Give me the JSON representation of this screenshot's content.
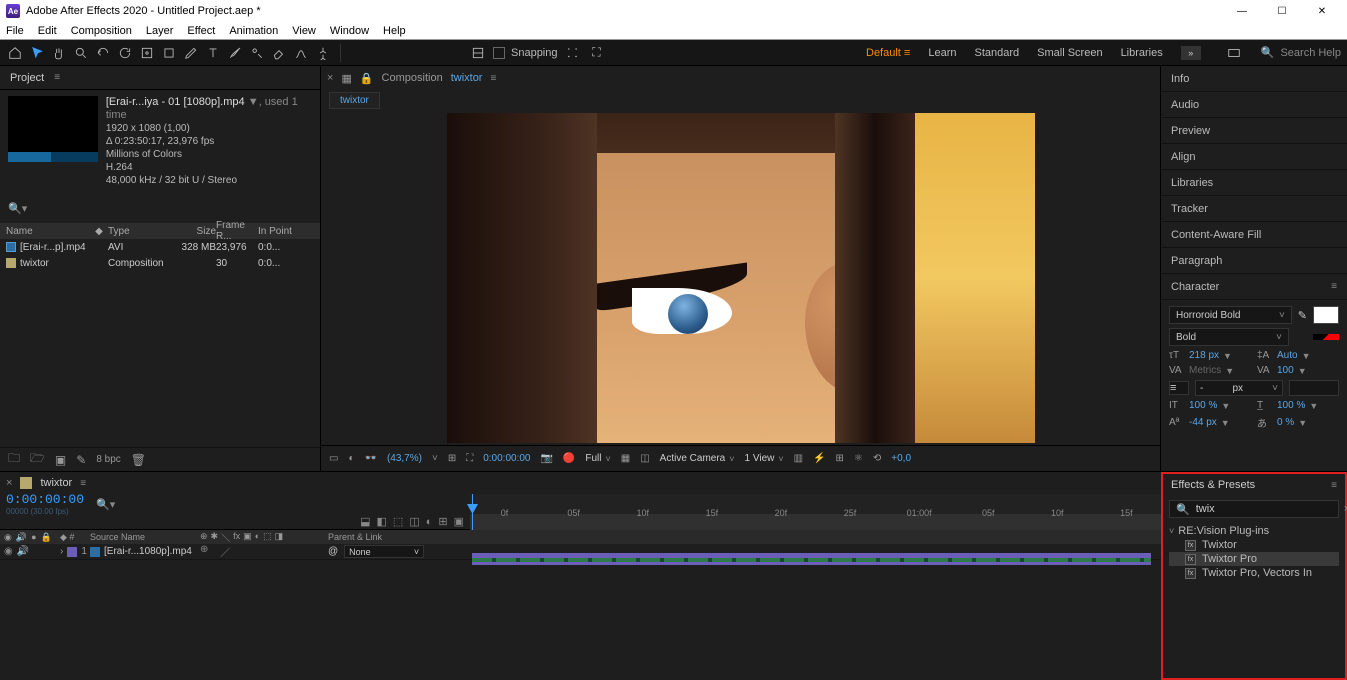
{
  "titlebar": {
    "app": "Adobe After Effects 2020",
    "doc": "Untitled Project.aep *"
  },
  "menu": [
    "File",
    "Edit",
    "Composition",
    "Layer",
    "Effect",
    "Animation",
    "View",
    "Window",
    "Help"
  ],
  "toolbar": {
    "snapping": "Snapping"
  },
  "workspace": {
    "default": "Default",
    "learn": "Learn",
    "standard": "Standard",
    "small": "Small Screen",
    "libraries": "Libraries"
  },
  "search": {
    "placeholder": "Search Help"
  },
  "project": {
    "tab": "Project",
    "source_name": "[Erai-r...iya - 01 [1080p].mp4",
    "source_drop": "▼",
    "source_used": ", used 1 time",
    "meta1": "1920 x 1080 (1,00)",
    "meta2": "Δ 0:23:50:17, 23,976 fps",
    "meta3": "Millions of Colors",
    "meta4": "H.264",
    "meta5": "48,000 kHz / 32 bit U / Stereo",
    "cols": {
      "name": "Name",
      "type": "Type",
      "size": "Size",
      "fr": "Frame R...",
      "inpt": "In Point"
    },
    "rows": [
      {
        "name": "[Erai-r...p].mp4",
        "type": "AVI",
        "size": "328 MB",
        "fr": "23,976",
        "inpt": "0:0..."
      },
      {
        "name": "twixtor",
        "type": "Composition",
        "size": "",
        "fr": "30",
        "inpt": "0:0..."
      }
    ],
    "bpc": "8 bpc"
  },
  "comp": {
    "label": "Composition",
    "name": "twixtor",
    "crumb": "twixtor"
  },
  "viewer": {
    "zoom": "(43,7%)",
    "time": "0:00:00:00",
    "res": "Full",
    "camera": "Active Camera",
    "view": "1 View",
    "exposure": "+0,0"
  },
  "panels_right": [
    "Info",
    "Audio",
    "Preview",
    "Align",
    "Libraries",
    "Tracker",
    "Content-Aware Fill",
    "Paragraph"
  ],
  "character": {
    "title": "Character",
    "font": "Horroroid Bold",
    "weight": "Bold",
    "size": "218",
    "size_unit": "px",
    "leading": "Auto",
    "kerning": "Metrics",
    "tracking": "100",
    "stroke_unit": "px",
    "vscale": "100",
    "vscale_u": "%",
    "hscale": "100",
    "hscale_u": "%",
    "baseline": "-44",
    "baseline_u": "px",
    "tsume": "0",
    "tsume_u": "%"
  },
  "timeline": {
    "tab": "twixtor",
    "timecode": "0:00:00:00",
    "sub": "00000 (30.00 fps)",
    "ruler": [
      "0f",
      "05f",
      "10f",
      "15f",
      "20f",
      "25f",
      "01:00f",
      "05f",
      "10f",
      "15f"
    ],
    "cols": {
      "src": "Source Name",
      "parent": "Parent & Link"
    },
    "layer": {
      "num": "1",
      "name": "[Erai-r...1080p].mp4",
      "parent": "None"
    }
  },
  "effects": {
    "title": "Effects & Presets",
    "query": "twix",
    "folder": "RE:Vision Plug-ins",
    "items": [
      "Twixtor",
      "Twixtor Pro",
      "Twixtor Pro, Vectors In"
    ]
  }
}
